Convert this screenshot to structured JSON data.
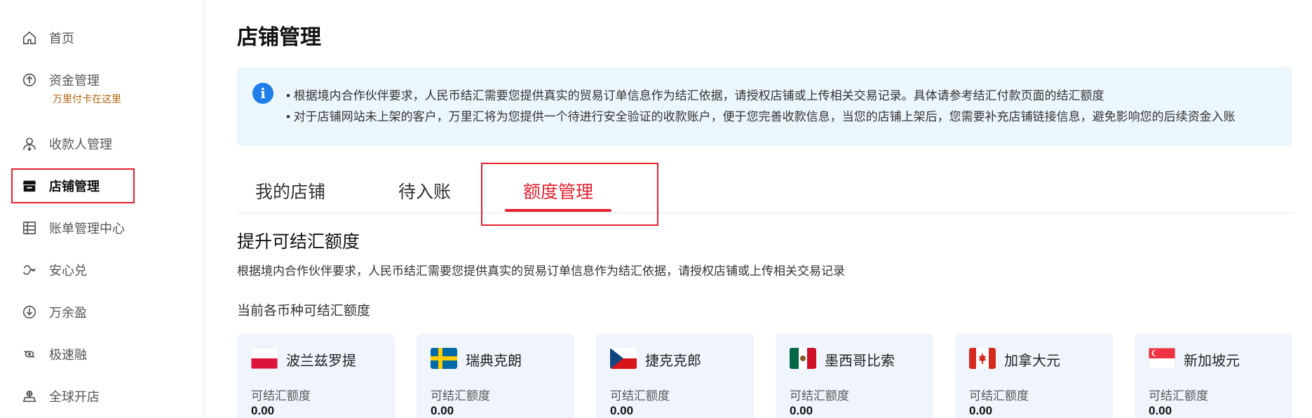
{
  "sidebar": {
    "items": [
      {
        "label": "首页",
        "icon": "home-icon"
      },
      {
        "label": "资金管理",
        "icon": "fund-up-icon",
        "sub": "万里付卡在这里"
      },
      {
        "label": "收款人管理",
        "icon": "payee-icon"
      },
      {
        "label": "店铺管理",
        "icon": "store-icon"
      },
      {
        "label": "账单管理中心",
        "icon": "bill-icon"
      },
      {
        "label": "安心兑",
        "icon": "exchange-icon"
      },
      {
        "label": "万余盈",
        "icon": "yield-icon"
      },
      {
        "label": "极速融",
        "icon": "loan-icon"
      },
      {
        "label": "全球开店",
        "icon": "global-store-icon"
      }
    ],
    "active_index": 3
  },
  "page": {
    "title": "店铺管理"
  },
  "notice": {
    "icon": "info-icon",
    "line1": "• 根据境内合作伙伴要求，人民币结汇需要您提供真实的贸易订单信息作为结汇依据，请授权店铺或上传相关交易记录。具体请参考结汇付款页面的结汇额度",
    "line2": "• 对于店铺网站未上架的客户，万里汇将为您提供一个待进行安全验证的收款账户，便于您完善收款信息，当您的店铺上架后，您需要补充店铺链接信息，避免影响您的后续资金入账"
  },
  "tabs": [
    {
      "label": "我的店铺"
    },
    {
      "label": "待入账"
    },
    {
      "label": "额度管理"
    }
  ],
  "active_tab": 2,
  "section": {
    "title": "提升可结汇额度",
    "desc": "根据境内合作伙伴要求，人民币结汇需要您提供真实的贸易订单信息作为结汇依据，请授权店铺或上传相关交易记录",
    "sub_title": "当前各币种可结汇额度"
  },
  "currencies": [
    {
      "name": "波兰兹罗提",
      "label": "可结汇额度",
      "value": "0.00",
      "flag": "poland-flag-icon"
    },
    {
      "name": "瑞典克朗",
      "label": "可结汇额度",
      "value": "0.00",
      "flag": "sweden-flag-icon"
    },
    {
      "name": "捷克克郎",
      "label": "可结汇额度",
      "value": "0.00",
      "flag": "czech-flag-icon"
    },
    {
      "name": "墨西哥比索",
      "label": "可结汇额度",
      "value": "0.00",
      "flag": "mexico-flag-icon"
    },
    {
      "name": "加拿大元",
      "label": "可结汇额度",
      "value": "0.00",
      "flag": "canada-flag-icon"
    },
    {
      "name": "新加坡元",
      "label": "可结汇额度",
      "value": "0.00",
      "flag": "singapore-flag-icon"
    }
  ],
  "colors": {
    "accent": "#e5212f",
    "info": "#1f7ee8",
    "notice_bg": "#ecf6fd",
    "card_bg": "#f0f5fd",
    "sub_link": "#b5650d"
  }
}
